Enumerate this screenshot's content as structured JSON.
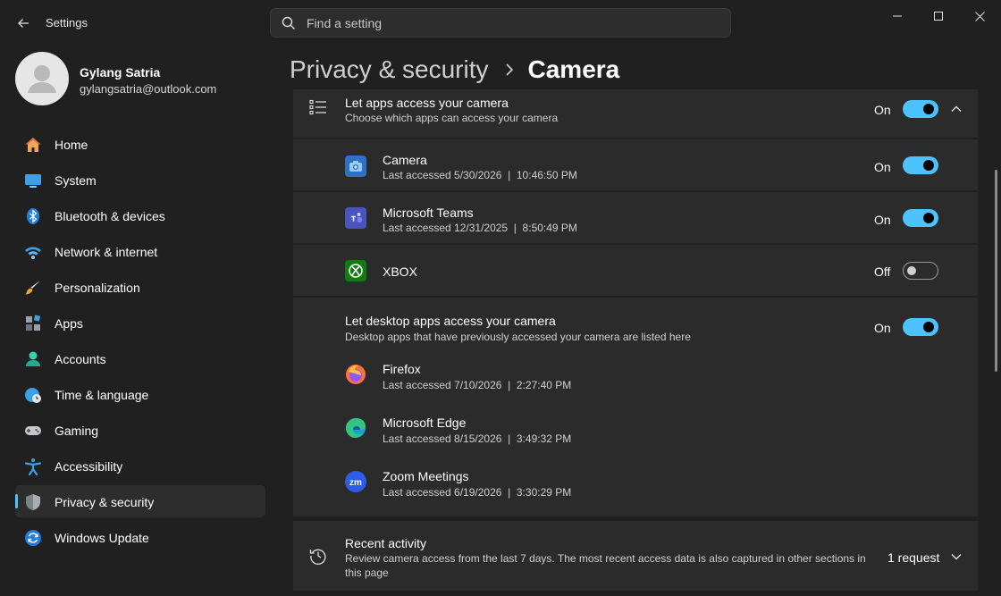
{
  "window": {
    "title": "Settings",
    "search_placeholder": "Find a setting"
  },
  "profile": {
    "name": "Gylang Satria",
    "email": "gylangsatria@outlook.com"
  },
  "sidebar": {
    "items": [
      {
        "label": "Home",
        "icon": "home-icon"
      },
      {
        "label": "System",
        "icon": "monitor-icon"
      },
      {
        "label": "Bluetooth & devices",
        "icon": "bluetooth-icon"
      },
      {
        "label": "Network & internet",
        "icon": "wifi-icon"
      },
      {
        "label": "Personalization",
        "icon": "brush-icon"
      },
      {
        "label": "Apps",
        "icon": "apps-icon"
      },
      {
        "label": "Accounts",
        "icon": "person-icon"
      },
      {
        "label": "Time & language",
        "icon": "clock-globe-icon"
      },
      {
        "label": "Gaming",
        "icon": "gamepad-icon"
      },
      {
        "label": "Accessibility",
        "icon": "accessibility-icon"
      },
      {
        "label": "Privacy & security",
        "icon": "shield-icon",
        "active": true
      },
      {
        "label": "Windows Update",
        "icon": "update-icon"
      }
    ]
  },
  "breadcrumb": {
    "parent": "Privacy & security",
    "current": "Camera"
  },
  "main": {
    "apps_access": {
      "title": "Let apps access your camera",
      "subtitle": "Choose which apps can access your camera",
      "state": "On"
    },
    "apps": [
      {
        "name": "Camera",
        "detail": "Last accessed 5/30/2026  |  10:46:50 PM",
        "state": "On"
      },
      {
        "name": "Microsoft Teams",
        "detail": "Last accessed 12/31/2025  |  8:50:49 PM",
        "state": "On"
      },
      {
        "name": "XBOX",
        "detail": "",
        "state": "Off"
      }
    ],
    "desktop_access": {
      "title": "Let desktop apps access your camera",
      "subtitle": "Desktop apps that have previously accessed your camera are listed here",
      "state": "On"
    },
    "desktop_apps": [
      {
        "name": "Firefox",
        "detail": "Last accessed 7/10/2026  |  2:27:40 PM"
      },
      {
        "name": "Microsoft Edge",
        "detail": "Last accessed 8/15/2026  |  3:49:32 PM"
      },
      {
        "name": "Zoom Meetings",
        "detail": "Last accessed 6/19/2026  |  3:30:29 PM"
      }
    ],
    "recent": {
      "title": "Recent activity",
      "subtitle_line1": "Review camera access from the last 7 days. The most recent access data is also captured in other sections in",
      "subtitle_line2": "this page",
      "count": "1 request"
    }
  },
  "colors": {
    "accent": "#4cc2ff",
    "background": "#202020",
    "card": "#2b2b2b"
  }
}
